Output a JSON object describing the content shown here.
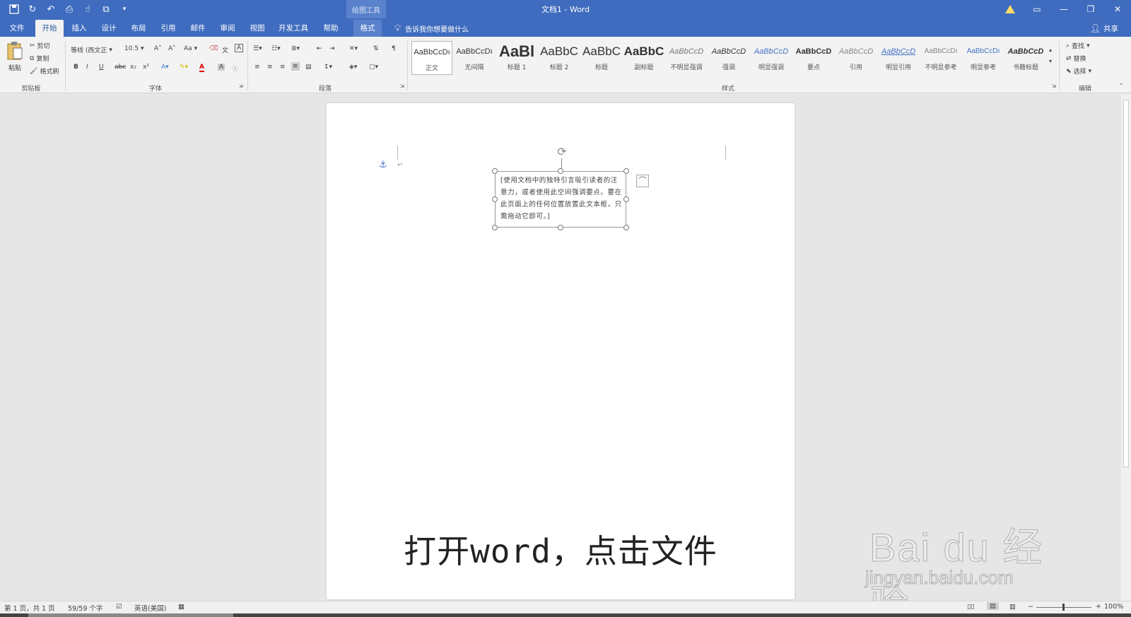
{
  "titlebar": {
    "title": "文档1 - Word",
    "context_tools": "绘图工具"
  },
  "tabs": [
    {
      "label": "文件",
      "id": "file"
    },
    {
      "label": "开始",
      "id": "home"
    },
    {
      "label": "插入",
      "id": "insert"
    },
    {
      "label": "设计",
      "id": "design"
    },
    {
      "label": "布局",
      "id": "layout"
    },
    {
      "label": "引用",
      "id": "references"
    },
    {
      "label": "邮件",
      "id": "mailings"
    },
    {
      "label": "审阅",
      "id": "review"
    },
    {
      "label": "视图",
      "id": "view"
    },
    {
      "label": "开发工具",
      "id": "developer"
    },
    {
      "label": "帮助",
      "id": "help"
    },
    {
      "label": "格式",
      "id": "format"
    }
  ],
  "tell_me": "告诉我你想要做什么",
  "share": "共享",
  "ribbon": {
    "clipboard": {
      "paste": "粘贴",
      "cut": "剪切",
      "copy": "复制",
      "format_painter": "格式刷",
      "label": "剪贴板"
    },
    "font": {
      "name": "等线 (西文正",
      "size": "10.5",
      "aa": "Aa",
      "bold": "B",
      "italic": "I",
      "underline": "U",
      "strike": "abc",
      "sub": "x₂",
      "sup": "x²",
      "label": "字体"
    },
    "paragraph": {
      "label": "段落"
    },
    "styles": {
      "label": "样式",
      "items": [
        {
          "preview": "AaBbCcDı",
          "name": "正文"
        },
        {
          "preview": "AaBbCcDı",
          "name": "无间隔"
        },
        {
          "preview": "AaBl",
          "name": "标题 1"
        },
        {
          "preview": "AaBbC",
          "name": "标题 2"
        },
        {
          "preview": "AaBbC",
          "name": "标题"
        },
        {
          "preview": "AaBbC",
          "name": "副标题"
        },
        {
          "preview": "AaBbCcD",
          "name": "不明显强调"
        },
        {
          "preview": "AaBbCcD",
          "name": "强调"
        },
        {
          "preview": "AaBbCcD",
          "name": "明显强调"
        },
        {
          "preview": "AaBbCcD",
          "name": "要点"
        },
        {
          "preview": "AaBbCcD",
          "name": "引用"
        },
        {
          "preview": "AaBbCcD",
          "name": "明显引用"
        },
        {
          "preview": "AaBbCcDı",
          "name": "不明显参考"
        },
        {
          "preview": "AaBbCcDı",
          "name": "明显参考"
        },
        {
          "preview": "AaBbCcD",
          "name": "书籍标题"
        }
      ]
    },
    "editing": {
      "find": "查找",
      "replace": "替换",
      "select": "选择",
      "label": "编辑"
    }
  },
  "document": {
    "textbox_text": "[使用文档中的独特引言吸引读者的注意力，或者使用此空间强调要点。要在此页面上的任何位置放置此文本框，只需拖动它即可。]"
  },
  "caption": "打开word，点击文件",
  "watermark": {
    "main": "Bai du 经验",
    "sub": "jingyan.baidu.com"
  },
  "statusbar": {
    "page": "第 1 页，共 1 页",
    "words": "59/59 个字",
    "language": "英语(美国)",
    "zoom": "100%"
  }
}
